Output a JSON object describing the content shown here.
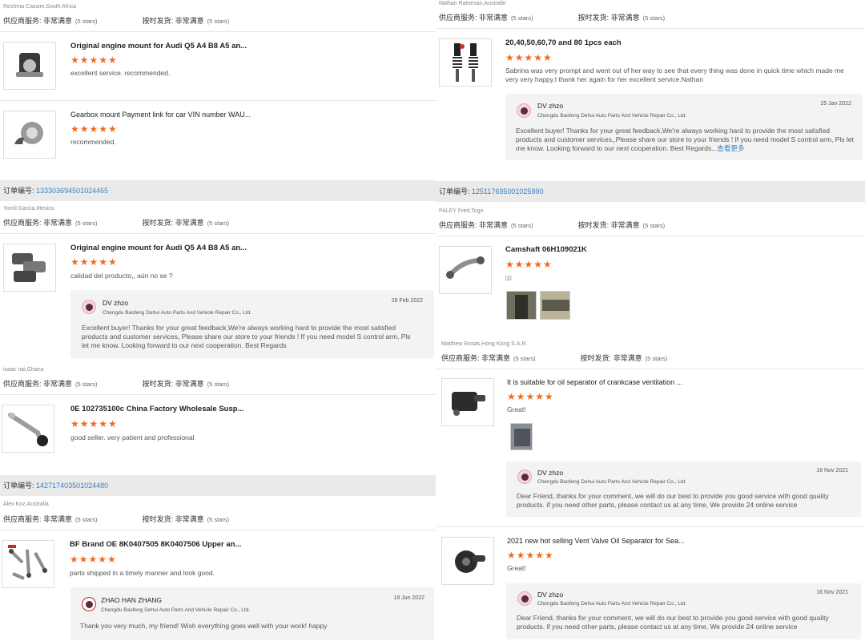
{
  "labels": {
    "order_prefix": "订单编号:",
    "supplier_service": "供应商服务:",
    "on_time": "按时发货:",
    "very_satisfied": "非常满意",
    "five_stars": "(5 stars)",
    "stars_glyphs": "★★★★★",
    "more": "查看更多"
  },
  "colors": {
    "star": "#f26b1d",
    "link": "#3b82c4",
    "order_bar": "#eaeaea",
    "reply_bg": "#f3f3f3"
  },
  "left": {
    "top_buyer": "Reshma Cassim,South Africa",
    "items1": [
      {
        "icon": "engine-mount-photo",
        "title": "Original engine mount for Audi Q5 A4 B8 A5 an...",
        "comment": "excellent service. recommended."
      },
      {
        "icon": "turbocharger-photo",
        "title": "Gearbox mount Payment link for car VIN number WAU...",
        "comment": "recommended."
      }
    ],
    "order2": {
      "number": "133303694501024465",
      "buyer": "Yomil Garcia,Mexico"
    },
    "item2": {
      "icon": "brake-pads-photo",
      "title": "Original engine mount for Audi Q5 A4 B8 A5 an...",
      "comment": "calidad del producto,, aún no se ?"
    },
    "reply2": {
      "name": "DV zhzo",
      "company": "Chengdu Baofeng Dehui Auto Parts And Vehicle Repair Co., Ltd.",
      "date": "28 Feb 2022",
      "text": "Excellent buyer! Thanks for your great feedback,We're always working hard to provide the most satisfied products and customer services, Please share our store to your friends ! If you need model S control arm, Pls let me know. Looking forward to our next cooperation. Best Regards"
    },
    "buyer3": "isaac nai,Ghana",
    "item3": {
      "icon": "control-arm-photo",
      "title": "0E 102735100c China Factory Wholesale Susp...",
      "comment": "good seller. very patient and professional"
    },
    "order4": {
      "number": "142717403501024480",
      "buyer": "Alex Koz,Australia"
    },
    "item4": {
      "icon": "control-arm-kit-photo",
      "title": "BF Brand OE 8K0407505 8K0407506 Upper an...",
      "comment": "parts shipped in a timely manner and look good."
    },
    "reply4": {
      "name": "ZHAO HAN ZHANG",
      "company": "Chengdu Baofeng Dehui Auto Parts And Vehicle Repair Co., Ltd.",
      "date": "19 Jun 2022",
      "text": "Thank you very much, my friend! Wish everything goes well with your work! happy"
    }
  },
  "right": {
    "top_buyer": "Nathan Ratnesan,Australie",
    "item1": {
      "icon": "air-struts-photo",
      "title": "20,40,50,60,70 and 80 1pcs each",
      "comment": "Sabrina was very prompt and went out of her way to see that every thing was done in quick time which made me very very happy.I thank her again for her excellent service.Nathan"
    },
    "reply1": {
      "name": "DV zhzo",
      "company": "Chengdu Baofeng Dehui Auto Parts And Vehicle Repair Co., Ltd.",
      "date": "25 Jan 2022",
      "text": "Excellent buyer! Thanks for your great feedback,We're always working hard to provide the most satisfied products and customer services,,Please share our store to your friends ! If you need model S control arm, Pls let me know. Looking forward to our next cooperation. Best Regards..."
    },
    "order2": {
      "number": "125117695001025990",
      "buyer": "PALEY Fred,Togo"
    },
    "item2": {
      "icon": "control-arm-photo",
      "title": "Camshaft 06H109021K",
      "comment": "▯▯"
    },
    "buyer3": "Matthew Rosas,Hong Kong S.A.R.",
    "item3": {
      "icon": "oil-separator-photo",
      "title": "It is suitable for oil separator of crankcase ventilation ...",
      "comment": "Great!"
    },
    "reply3": {
      "name": "DV zhzo",
      "company": "Chengdu Baofeng Dehui Auto Parts And Vehicle Repair Co., Ltd.",
      "date": "16 Nov 2021",
      "text": "Dear Friend, thanks for your comment, we will do our best to provide you good service with good quality products. if you need other parts, please contact us at any time, We provide 24 online service"
    },
    "item4": {
      "icon": "vent-valve-photo",
      "title": "2021 new hot selling Vent Valve Oil Separator for Sea...",
      "comment": "Great!"
    },
    "reply4": {
      "name": "DV zhzo",
      "company": "Chengdu Baofeng Dehui Auto Parts And Vehicle Repair Co., Ltd.",
      "date": "16 Nov 2021",
      "text": "Dear Friend, thanks for your comment, we will do our best to provide you good service with good quality products. if you need other parts, please contact us at any time, We provide 24 online service"
    }
  }
}
